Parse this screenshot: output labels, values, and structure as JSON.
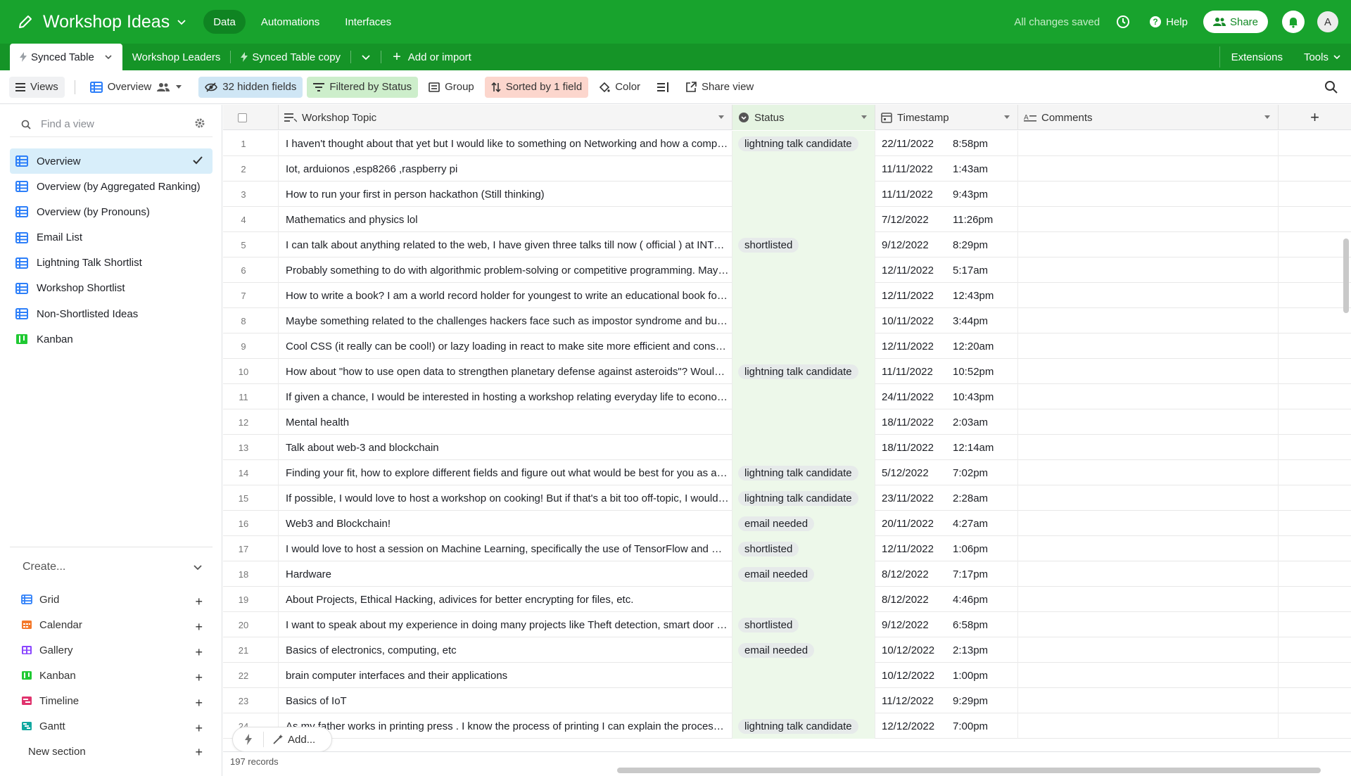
{
  "header": {
    "base_title": "Workshop Ideas",
    "nav": [
      "Data",
      "Automations",
      "Interfaces"
    ],
    "saved_status": "All changes saved",
    "help_label": "Help",
    "share_label": "Share",
    "avatar_initial": "A",
    "brand_color": "#18a32d"
  },
  "tabs": {
    "items": [
      "Synced Table",
      "Workshop Leaders",
      "Synced Table copy"
    ],
    "add_label": "Add or import",
    "extensions_label": "Extensions",
    "tools_label": "Tools"
  },
  "viewbar": {
    "views_label": "Views",
    "current_view": "Overview",
    "hidden_fields": "32 hidden fields",
    "filtered": "Filtered by Status",
    "group": "Group",
    "sorted": "Sorted by 1 field",
    "color": "Color",
    "share_view": "Share view"
  },
  "sidebar": {
    "find_placeholder": "Find a view",
    "views": [
      {
        "label": "Overview",
        "icon": "grid-icon",
        "active": true
      },
      {
        "label": "Overview (by Aggregated Ranking)",
        "icon": "grid-icon"
      },
      {
        "label": "Overview (by Pronouns)",
        "icon": "grid-icon"
      },
      {
        "label": "Email List",
        "icon": "grid-icon"
      },
      {
        "label": "Lightning Talk Shortlist",
        "icon": "grid-icon"
      },
      {
        "label": "Workshop Shortlist",
        "icon": "grid-icon"
      },
      {
        "label": "Non-Shortlisted Ideas",
        "icon": "grid-icon"
      },
      {
        "label": "Kanban",
        "icon": "kanban-icon"
      }
    ],
    "create_label": "Create...",
    "create_items": [
      {
        "label": "Grid",
        "color": "#2d7ff9"
      },
      {
        "label": "Calendar",
        "color": "#f4792b"
      },
      {
        "label": "Gallery",
        "color": "#8b46ff"
      },
      {
        "label": "Kanban",
        "color": "#20c933"
      },
      {
        "label": "Timeline",
        "color": "#e0336d"
      },
      {
        "label": "Gantt",
        "color": "#11a8a0"
      }
    ],
    "new_section_label": "New section"
  },
  "grid": {
    "columns": [
      "Workshop Topic",
      "Status",
      "Timestamp",
      "Comments"
    ],
    "rows": [
      {
        "n": "1",
        "topic": "I haven't thought about that yet but I would like to something on Networking and how a computer works",
        "status": "lightning talk candidate",
        "date": "22/11/2022",
        "time": "8:58pm"
      },
      {
        "n": "2",
        "topic": "Iot, arduionos ,esp8266 ,raspberry pi",
        "status": "",
        "date": "11/11/2022",
        "time": "1:43am"
      },
      {
        "n": "3",
        "topic": "How to run your first in person hackathon (Still thinking)",
        "status": "",
        "date": "11/11/2022",
        "time": "9:43pm"
      },
      {
        "n": "4",
        "topic": "Mathematics and physics lol",
        "status": "",
        "date": "7/12/2022",
        "time": "11:26pm"
      },
      {
        "n": "5",
        "topic": "I can talk about anything related to the web, I have given three talks till now ( official ) at INTEL, and more",
        "status": "shortlisted",
        "date": "9/12/2022",
        "time": "8:29pm"
      },
      {
        "n": "6",
        "topic": "Probably something to do with algorithmic problem-solving or competitive programming. Maybe a workshop",
        "status": "",
        "date": "12/11/2022",
        "time": "5:17am"
      },
      {
        "n": "7",
        "topic": "How to write a book? I am a world record holder for youngest to write an educational book for teens",
        "status": "",
        "date": "12/11/2022",
        "time": "12:43pm"
      },
      {
        "n": "8",
        "topic": "Maybe something related to the challenges hackers face such as impostor syndrome and burnout",
        "status": "",
        "date": "10/11/2022",
        "time": "3:44pm"
      },
      {
        "n": "9",
        "topic": "Cool CSS (it really can be cool!) or lazy loading in react to make site more efficient and consume less",
        "status": "",
        "date": "12/11/2022",
        "time": "12:20am"
      },
      {
        "n": "10",
        "topic": "How about \"how to use open data to strengthen planetary defense against asteroids\"? Would that work",
        "status": "lightning talk candidate",
        "date": "11/11/2022",
        "time": "10:52pm"
      },
      {
        "n": "11",
        "topic": "If given a chance, I would be interested in hosting a workshop relating everyday life to economics",
        "status": "",
        "date": "24/11/2022",
        "time": "10:43pm"
      },
      {
        "n": "12",
        "topic": "Mental health",
        "status": "",
        "date": "18/11/2022",
        "time": "2:03am"
      },
      {
        "n": "13",
        "topic": "Talk about web-3 and blockchain",
        "status": "",
        "date": "18/11/2022",
        "time": "12:14am"
      },
      {
        "n": "14",
        "topic": "Finding your fit, how to explore different fields and figure out what would be best for you as a student",
        "status": "lightning talk candidate",
        "date": "5/12/2022",
        "time": "7:02pm"
      },
      {
        "n": "15",
        "topic": "If possible, I would love to host a workshop on cooking! But if that's a bit too off-topic, I would love to",
        "status": "lightning talk candidate",
        "date": "23/11/2022",
        "time": "2:28am"
      },
      {
        "n": "16",
        "topic": "Web3 and Blockchain!",
        "status": "email needed",
        "date": "20/11/2022",
        "time": "4:27am"
      },
      {
        "n": "17",
        "topic": "I would love to host a session on Machine Learning, specifically the use of TensorFlow and Keras for beginners",
        "status": "shortlisted",
        "date": "12/11/2022",
        "time": "1:06pm"
      },
      {
        "n": "18",
        "topic": "Hardware",
        "status": "email needed",
        "date": "8/12/2022",
        "time": "7:17pm"
      },
      {
        "n": "19",
        "topic": "About Projects, Ethical Hacking, adivices for better encrypting for files, etc.",
        "status": "",
        "date": "8/12/2022",
        "time": "4:46pm"
      },
      {
        "n": "20",
        "topic": "I want to speak about my experience in doing many projects like Theft detection, smart door bell and more",
        "status": "shortlisted",
        "date": "9/12/2022",
        "time": "6:58pm"
      },
      {
        "n": "21",
        "topic": "Basics of electronics, computing, etc",
        "status": "email needed",
        "date": "10/12/2022",
        "time": "2:13pm"
      },
      {
        "n": "22",
        "topic": "brain computer interfaces and their applications",
        "status": "",
        "date": "10/12/2022",
        "time": "1:00pm"
      },
      {
        "n": "23",
        "topic": "Basics of IoT",
        "status": "",
        "date": "11/12/2022",
        "time": "9:29pm"
      },
      {
        "n": "24",
        "topic": "As my father works in printing press . I know the process of printing I can explain the process properly",
        "status": "lightning talk candidate",
        "date": "12/12/2022",
        "time": "7:00pm"
      }
    ],
    "add_label": "Add...",
    "record_count": "197 records"
  }
}
